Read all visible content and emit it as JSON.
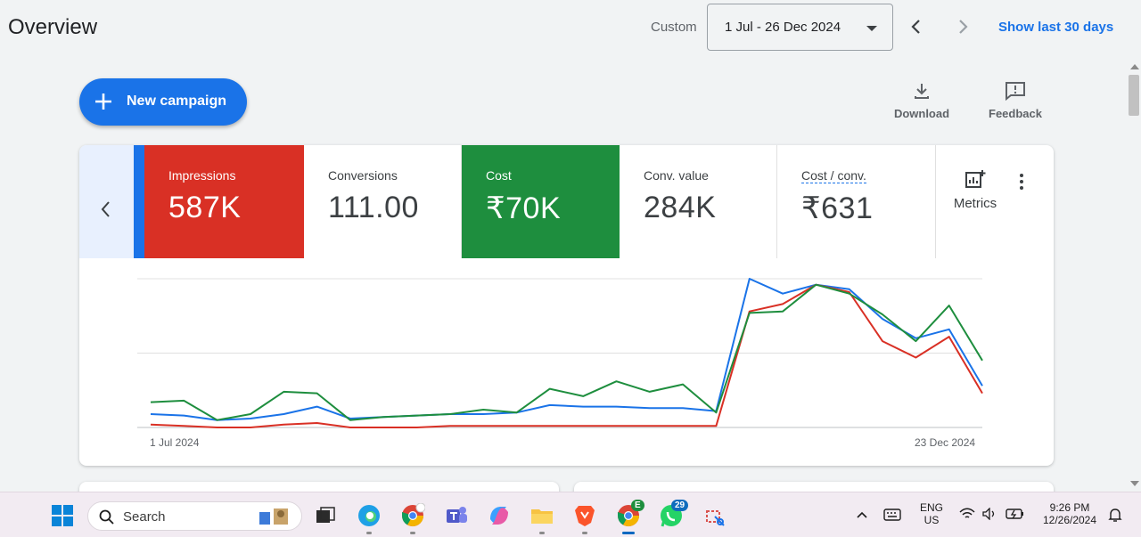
{
  "header": {
    "title": "Overview",
    "custom_label": "Custom",
    "date_range": "1 Jul - 26 Dec 2024",
    "show_last": "Show last 30 days"
  },
  "actions": {
    "new_campaign": "New campaign",
    "download": "Download",
    "feedback": "Feedback"
  },
  "metrics": [
    {
      "name": "Impressions",
      "value": "587K",
      "color": "#d93025"
    },
    {
      "name": "Conversions",
      "value": "111.00"
    },
    {
      "name": "Cost",
      "value": "₹70K",
      "color": "#1e8e3e"
    },
    {
      "name": "Conv. value",
      "value": "284K"
    },
    {
      "name": "Cost / conv.",
      "value": "₹631"
    }
  ],
  "metrics_button": "Metrics",
  "chart_data": {
    "type": "line",
    "x_start_label": "1 Jul 2024",
    "x_end_label": "23 Dec 2024",
    "grid": true,
    "ylim": [
      0,
      100
    ],
    "series": [
      {
        "color": "#1a73e8",
        "values": [
          9,
          8,
          5,
          6,
          9,
          14,
          6,
          7,
          8,
          9,
          9,
          10,
          15,
          14,
          14,
          13,
          13,
          11,
          100,
          90,
          96,
          93,
          73,
          60,
          66,
          28
        ]
      },
      {
        "color": "#d93025",
        "values": [
          2,
          1,
          0,
          0,
          2,
          3,
          0,
          0,
          0,
          1,
          1,
          1,
          1,
          1,
          1,
          1,
          1,
          1,
          78,
          83,
          96,
          91,
          58,
          47,
          61,
          23
        ]
      },
      {
        "color": "#1e8e3e",
        "values": [
          17,
          18,
          5,
          9,
          24,
          23,
          5,
          7,
          8,
          9,
          12,
          10,
          26,
          21,
          31,
          24,
          29,
          10,
          77,
          78,
          96,
          90,
          76,
          58,
          82,
          45
        ]
      }
    ]
  },
  "taskbar": {
    "search_placeholder": "Search",
    "language": "ENG",
    "region": "US",
    "time": "9:26 PM",
    "date": "12/26/2024",
    "whatsapp_badge": "29",
    "chrome_badge": "E"
  }
}
